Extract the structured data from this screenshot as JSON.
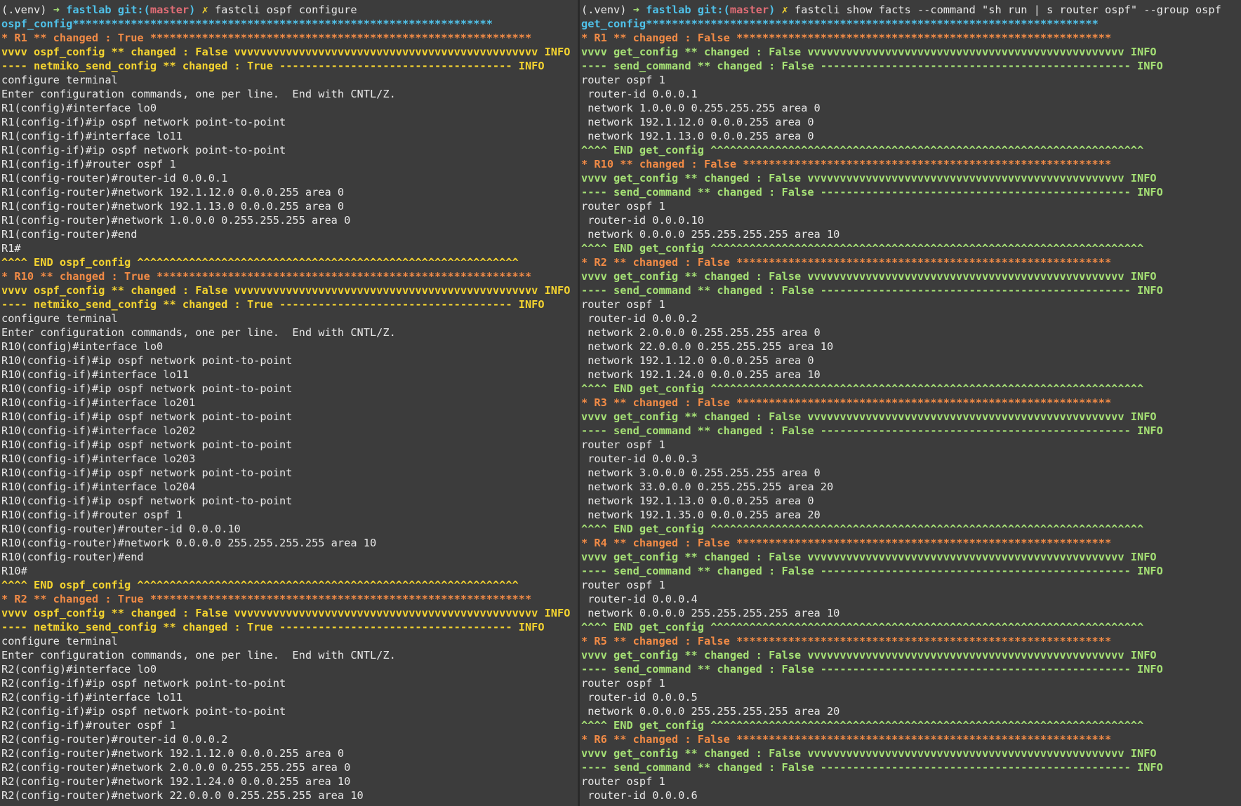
{
  "colors": {
    "background": "#3c3c3c",
    "text": "#e8e8e8",
    "cyan": "#4fc1e9",
    "orange": "#f28b46",
    "yellow": "#f5d430",
    "green": "#a5e075",
    "red": "#e06c75"
  },
  "panes": [
    {
      "id": "left",
      "lines": [
        [
          {
            "t": "(.venv) ",
            "c": "w"
          },
          {
            "t": "➜ ",
            "c": "g",
            "b": 1
          },
          {
            "t": "fastlab ",
            "c": "c",
            "b": 1
          },
          {
            "t": "git:(",
            "c": "c",
            "b": 1
          },
          {
            "t": "master",
            "c": "r",
            "b": 1
          },
          {
            "t": ") ",
            "c": "c",
            "b": 1
          },
          {
            "t": "✗ ",
            "c": "y",
            "b": 1
          },
          {
            "t": "fastcli ospf configure",
            "c": "w"
          }
        ],
        [
          {
            "t": "ospf_config",
            "c": "c",
            "b": 1
          },
          {
            "t": "*****************************************************************",
            "c": "c",
            "b": 1
          }
        ],
        [
          {
            "t": "* R1 ** changed : True ***********************************************************",
            "c": "o",
            "b": 1
          }
        ],
        [
          {
            "t": "vvvv ospf_config ** changed : False vvvvvvvvvvvvvvvvvvvvvvvvvvvvvvvvvvvvvvvvvvvvvvv INFO",
            "c": "y",
            "b": 1
          }
        ],
        [
          {
            "t": "---- netmiko_send_config ** changed : True ------------------------------------ INFO",
            "c": "y",
            "b": 1
          }
        ],
        [
          {
            "t": "configure terminal",
            "c": "w"
          }
        ],
        [
          {
            "t": "Enter configuration commands, one per line.  End with CNTL/Z.",
            "c": "w"
          }
        ],
        [
          {
            "t": "R1(config)#interface lo0",
            "c": "w"
          }
        ],
        [
          {
            "t": "R1(config-if)#ip ospf network point-to-point",
            "c": "w"
          }
        ],
        [
          {
            "t": "R1(config-if)#interface lo11",
            "c": "w"
          }
        ],
        [
          {
            "t": "R1(config-if)#ip ospf network point-to-point",
            "c": "w"
          }
        ],
        [
          {
            "t": "R1(config-if)#router ospf 1",
            "c": "w"
          }
        ],
        [
          {
            "t": "R1(config-router)#router-id 0.0.0.1",
            "c": "w"
          }
        ],
        [
          {
            "t": "R1(config-router)#network 192.1.12.0 0.0.0.255 area 0",
            "c": "w"
          }
        ],
        [
          {
            "t": "R1(config-router)#network 192.1.13.0 0.0.0.255 area 0",
            "c": "w"
          }
        ],
        [
          {
            "t": "R1(config-router)#network 1.0.0.0 0.255.255.255 area 0",
            "c": "w"
          }
        ],
        [
          {
            "t": "R1(config-router)#end",
            "c": "w"
          }
        ],
        [
          {
            "t": "R1#",
            "c": "w"
          }
        ],
        [
          {
            "t": "^^^^ END ospf_config ^^^^^^^^^^^^^^^^^^^^^^^^^^^^^^^^^^^^^^^^^^^^^^^^^^^^^^^^^^^",
            "c": "y",
            "b": 1
          }
        ],
        [
          {
            "t": "* R10 ** changed : True **********************************************************",
            "c": "o",
            "b": 1
          }
        ],
        [
          {
            "t": "vvvv ospf_config ** changed : False vvvvvvvvvvvvvvvvvvvvvvvvvvvvvvvvvvvvvvvvvvvvvvv INFO",
            "c": "y",
            "b": 1
          }
        ],
        [
          {
            "t": "---- netmiko_send_config ** changed : True ------------------------------------ INFO",
            "c": "y",
            "b": 1
          }
        ],
        [
          {
            "t": "configure terminal",
            "c": "w"
          }
        ],
        [
          {
            "t": "Enter configuration commands, one per line.  End with CNTL/Z.",
            "c": "w"
          }
        ],
        [
          {
            "t": "R10(config)#interface lo0",
            "c": "w"
          }
        ],
        [
          {
            "t": "R10(config-if)#ip ospf network point-to-point",
            "c": "w"
          }
        ],
        [
          {
            "t": "R10(config-if)#interface lo11",
            "c": "w"
          }
        ],
        [
          {
            "t": "R10(config-if)#ip ospf network point-to-point",
            "c": "w"
          }
        ],
        [
          {
            "t": "R10(config-if)#interface lo201",
            "c": "w"
          }
        ],
        [
          {
            "t": "R10(config-if)#ip ospf network point-to-point",
            "c": "w"
          }
        ],
        [
          {
            "t": "R10(config-if)#interface lo202",
            "c": "w"
          }
        ],
        [
          {
            "t": "R10(config-if)#ip ospf network point-to-point",
            "c": "w"
          }
        ],
        [
          {
            "t": "R10(config-if)#interface lo203",
            "c": "w"
          }
        ],
        [
          {
            "t": "R10(config-if)#ip ospf network point-to-point",
            "c": "w"
          }
        ],
        [
          {
            "t": "R10(config-if)#interface lo204",
            "c": "w"
          }
        ],
        [
          {
            "t": "R10(config-if)#ip ospf network point-to-point",
            "c": "w"
          }
        ],
        [
          {
            "t": "R10(config-if)#router ospf 1",
            "c": "w"
          }
        ],
        [
          {
            "t": "R10(config-router)#router-id 0.0.0.10",
            "c": "w"
          }
        ],
        [
          {
            "t": "R10(config-router)#network 0.0.0.0 255.255.255.255 area 10",
            "c": "w"
          }
        ],
        [
          {
            "t": "R10(config-router)#end",
            "c": "w"
          }
        ],
        [
          {
            "t": "R10#",
            "c": "w"
          }
        ],
        [
          {
            "t": "^^^^ END ospf_config ^^^^^^^^^^^^^^^^^^^^^^^^^^^^^^^^^^^^^^^^^^^^^^^^^^^^^^^^^^^",
            "c": "y",
            "b": 1
          }
        ],
        [
          {
            "t": "* R2 ** changed : True ***********************************************************",
            "c": "o",
            "b": 1
          }
        ],
        [
          {
            "t": "vvvv ospf_config ** changed : False vvvvvvvvvvvvvvvvvvvvvvvvvvvvvvvvvvvvvvvvvvvvvvv INFO",
            "c": "y",
            "b": 1
          }
        ],
        [
          {
            "t": "---- netmiko_send_config ** changed : True ------------------------------------ INFO",
            "c": "y",
            "b": 1
          }
        ],
        [
          {
            "t": "configure terminal",
            "c": "w"
          }
        ],
        [
          {
            "t": "Enter configuration commands, one per line.  End with CNTL/Z.",
            "c": "w"
          }
        ],
        [
          {
            "t": "R2(config)#interface lo0",
            "c": "w"
          }
        ],
        [
          {
            "t": "R2(config-if)#ip ospf network point-to-point",
            "c": "w"
          }
        ],
        [
          {
            "t": "R2(config-if)#interface lo11",
            "c": "w"
          }
        ],
        [
          {
            "t": "R2(config-if)#ip ospf network point-to-point",
            "c": "w"
          }
        ],
        [
          {
            "t": "R2(config-if)#router ospf 1",
            "c": "w"
          }
        ],
        [
          {
            "t": "R2(config-router)#router-id 0.0.0.2",
            "c": "w"
          }
        ],
        [
          {
            "t": "R2(config-router)#network 192.1.12.0 0.0.0.255 area 0",
            "c": "w"
          }
        ],
        [
          {
            "t": "R2(config-router)#network 2.0.0.0 0.255.255.255 area 0",
            "c": "w"
          }
        ],
        [
          {
            "t": "R2(config-router)#network 192.1.24.0 0.0.0.255 area 10",
            "c": "w"
          }
        ],
        [
          {
            "t": "R2(config-router)#network 22.0.0.0 0.255.255.255 area 10",
            "c": "w"
          }
        ]
      ]
    },
    {
      "id": "right",
      "lines": [
        [
          {
            "t": "(.venv) ",
            "c": "w"
          },
          {
            "t": "➜ ",
            "c": "g",
            "b": 1
          },
          {
            "t": "fastlab ",
            "c": "c",
            "b": 1
          },
          {
            "t": "git:(",
            "c": "c",
            "b": 1
          },
          {
            "t": "master",
            "c": "r",
            "b": 1
          },
          {
            "t": ") ",
            "c": "c",
            "b": 1
          },
          {
            "t": "✗ ",
            "c": "y",
            "b": 1
          },
          {
            "t": "fastcli show facts --command \"sh run | s router ospf\" --group ospf",
            "c": "w"
          }
        ],
        [
          {
            "t": "get_config",
            "c": "c",
            "b": 1
          },
          {
            "t": "**********************************************************************",
            "c": "c",
            "b": 1
          }
        ],
        [
          {
            "t": "* R1 ** changed : False **********************************************************",
            "c": "o",
            "b": 1
          }
        ],
        [
          {
            "t": "vvvv get_config ** changed : False vvvvvvvvvvvvvvvvvvvvvvvvvvvvvvvvvvvvvvvvvvvvvvvvv INFO",
            "c": "g",
            "b": 1
          }
        ],
        [
          {
            "t": "---- send_command ** changed : False ------------------------------------------------ INFO",
            "c": "g",
            "b": 1
          }
        ],
        [
          {
            "t": "router ospf 1",
            "c": "w"
          }
        ],
        [
          {
            "t": " router-id 0.0.0.1",
            "c": "w"
          }
        ],
        [
          {
            "t": " network 1.0.0.0 0.255.255.255 area 0",
            "c": "w"
          }
        ],
        [
          {
            "t": " network 192.1.12.0 0.0.0.255 area 0",
            "c": "w"
          }
        ],
        [
          {
            "t": " network 192.1.13.0 0.0.0.255 area 0",
            "c": "w"
          }
        ],
        [
          {
            "t": "^^^^ END get_config ^^^^^^^^^^^^^^^^^^^^^^^^^^^^^^^^^^^^^^^^^^^^^^^^^^^^^^^^^^^^^^^^^^^",
            "c": "g",
            "b": 1
          }
        ],
        [
          {
            "t": "* R10 ** changed : False *********************************************************",
            "c": "o",
            "b": 1
          }
        ],
        [
          {
            "t": "vvvv get_config ** changed : False vvvvvvvvvvvvvvvvvvvvvvvvvvvvvvvvvvvvvvvvvvvvvvvvv INFO",
            "c": "g",
            "b": 1
          }
        ],
        [
          {
            "t": "---- send_command ** changed : False ------------------------------------------------ INFO",
            "c": "g",
            "b": 1
          }
        ],
        [
          {
            "t": "router ospf 1",
            "c": "w"
          }
        ],
        [
          {
            "t": " router-id 0.0.0.10",
            "c": "w"
          }
        ],
        [
          {
            "t": " network 0.0.0.0 255.255.255.255 area 10",
            "c": "w"
          }
        ],
        [
          {
            "t": "^^^^ END get_config ^^^^^^^^^^^^^^^^^^^^^^^^^^^^^^^^^^^^^^^^^^^^^^^^^^^^^^^^^^^^^^^^^^^",
            "c": "g",
            "b": 1
          }
        ],
        [
          {
            "t": "* R2 ** changed : False **********************************************************",
            "c": "o",
            "b": 1
          }
        ],
        [
          {
            "t": "vvvv get_config ** changed : False vvvvvvvvvvvvvvvvvvvvvvvvvvvvvvvvvvvvvvvvvvvvvvvvv INFO",
            "c": "g",
            "b": 1
          }
        ],
        [
          {
            "t": "---- send_command ** changed : False ------------------------------------------------ INFO",
            "c": "g",
            "b": 1
          }
        ],
        [
          {
            "t": "router ospf 1",
            "c": "w"
          }
        ],
        [
          {
            "t": " router-id 0.0.0.2",
            "c": "w"
          }
        ],
        [
          {
            "t": " network 2.0.0.0 0.255.255.255 area 0",
            "c": "w"
          }
        ],
        [
          {
            "t": " network 22.0.0.0 0.255.255.255 area 10",
            "c": "w"
          }
        ],
        [
          {
            "t": " network 192.1.12.0 0.0.0.255 area 0",
            "c": "w"
          }
        ],
        [
          {
            "t": " network 192.1.24.0 0.0.0.255 area 10",
            "c": "w"
          }
        ],
        [
          {
            "t": "^^^^ END get_config ^^^^^^^^^^^^^^^^^^^^^^^^^^^^^^^^^^^^^^^^^^^^^^^^^^^^^^^^^^^^^^^^^^^",
            "c": "g",
            "b": 1
          }
        ],
        [
          {
            "t": "* R3 ** changed : False **********************************************************",
            "c": "o",
            "b": 1
          }
        ],
        [
          {
            "t": "vvvv get_config ** changed : False vvvvvvvvvvvvvvvvvvvvvvvvvvvvvvvvvvvvvvvvvvvvvvvvv INFO",
            "c": "g",
            "b": 1
          }
        ],
        [
          {
            "t": "---- send_command ** changed : False ------------------------------------------------ INFO",
            "c": "g",
            "b": 1
          }
        ],
        [
          {
            "t": "router ospf 1",
            "c": "w"
          }
        ],
        [
          {
            "t": " router-id 0.0.0.3",
            "c": "w"
          }
        ],
        [
          {
            "t": " network 3.0.0.0 0.255.255.255 area 0",
            "c": "w"
          }
        ],
        [
          {
            "t": " network 33.0.0.0 0.255.255.255 area 20",
            "c": "w"
          }
        ],
        [
          {
            "t": " network 192.1.13.0 0.0.0.255 area 0",
            "c": "w"
          }
        ],
        [
          {
            "t": " network 192.1.35.0 0.0.0.255 area 20",
            "c": "w"
          }
        ],
        [
          {
            "t": "^^^^ END get_config ^^^^^^^^^^^^^^^^^^^^^^^^^^^^^^^^^^^^^^^^^^^^^^^^^^^^^^^^^^^^^^^^^^^",
            "c": "g",
            "b": 1
          }
        ],
        [
          {
            "t": "* R4 ** changed : False **********************************************************",
            "c": "o",
            "b": 1
          }
        ],
        [
          {
            "t": "vvvv get_config ** changed : False vvvvvvvvvvvvvvvvvvvvvvvvvvvvvvvvvvvvvvvvvvvvvvvvv INFO",
            "c": "g",
            "b": 1
          }
        ],
        [
          {
            "t": "---- send_command ** changed : False ------------------------------------------------ INFO",
            "c": "g",
            "b": 1
          }
        ],
        [
          {
            "t": "router ospf 1",
            "c": "w"
          }
        ],
        [
          {
            "t": " router-id 0.0.0.4",
            "c": "w"
          }
        ],
        [
          {
            "t": " network 0.0.0.0 255.255.255.255 area 10",
            "c": "w"
          }
        ],
        [
          {
            "t": "^^^^ END get_config ^^^^^^^^^^^^^^^^^^^^^^^^^^^^^^^^^^^^^^^^^^^^^^^^^^^^^^^^^^^^^^^^^^^",
            "c": "g",
            "b": 1
          }
        ],
        [
          {
            "t": "* R5 ** changed : False **********************************************************",
            "c": "o",
            "b": 1
          }
        ],
        [
          {
            "t": "vvvv get_config ** changed : False vvvvvvvvvvvvvvvvvvvvvvvvvvvvvvvvvvvvvvvvvvvvvvvvv INFO",
            "c": "g",
            "b": 1
          }
        ],
        [
          {
            "t": "---- send_command ** changed : False ------------------------------------------------ INFO",
            "c": "g",
            "b": 1
          }
        ],
        [
          {
            "t": "router ospf 1",
            "c": "w"
          }
        ],
        [
          {
            "t": " router-id 0.0.0.5",
            "c": "w"
          }
        ],
        [
          {
            "t": " network 0.0.0.0 255.255.255.255 area 20",
            "c": "w"
          }
        ],
        [
          {
            "t": "^^^^ END get_config ^^^^^^^^^^^^^^^^^^^^^^^^^^^^^^^^^^^^^^^^^^^^^^^^^^^^^^^^^^^^^^^^^^^",
            "c": "g",
            "b": 1
          }
        ],
        [
          {
            "t": "* R6 ** changed : False **********************************************************",
            "c": "o",
            "b": 1
          }
        ],
        [
          {
            "t": "vvvv get_config ** changed : False vvvvvvvvvvvvvvvvvvvvvvvvvvvvvvvvvvvvvvvvvvvvvvvvv INFO",
            "c": "g",
            "b": 1
          }
        ],
        [
          {
            "t": "---- send_command ** changed : False ------------------------------------------------ INFO",
            "c": "g",
            "b": 1
          }
        ],
        [
          {
            "t": "router ospf 1",
            "c": "w"
          }
        ],
        [
          {
            "t": " router-id 0.0.0.6",
            "c": "w"
          }
        ]
      ]
    }
  ]
}
